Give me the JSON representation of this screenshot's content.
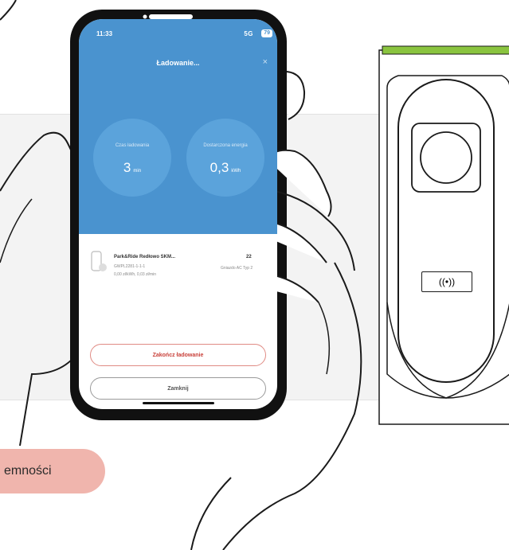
{
  "pill_text": "emności",
  "phone": {
    "status": {
      "time": "11:33",
      "signal": "5G",
      "battery": "79"
    },
    "title": "Ładowanie...",
    "close_symbol": "×",
    "stats": [
      {
        "label": "Czas ładowania",
        "value": "3",
        "unit": "min"
      },
      {
        "label": "Dostarczona energia",
        "value": "0,3",
        "unit": "kWh"
      }
    ],
    "station": {
      "name": "Park&Ride Redłowo SKM...",
      "id": "GWPL2281-1-1-1",
      "price": "0,00 zł/kWh, 0,03 zł/min",
      "power": "22",
      "connector": "Gniazdo AC Typ 2"
    },
    "buttons": {
      "end": "Zakończ ładowanie",
      "close": "Zamknij"
    }
  },
  "charger": {
    "rfid_symbol": "((•))"
  },
  "colors": {
    "screen_blue": "#4a93cf",
    "accent_red": "#c9413a",
    "pill": "#f0b5ad",
    "charger_green": "#8ac43f"
  }
}
